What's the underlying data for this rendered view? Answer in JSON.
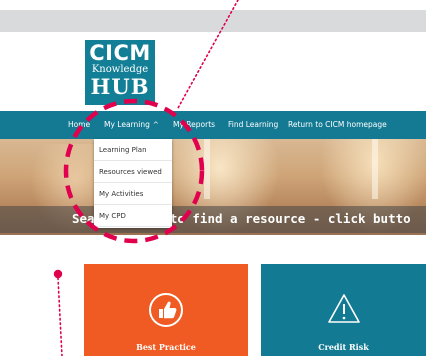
{
  "logo": {
    "line1": "CICM",
    "line2": "Knowledge",
    "line3": "HUB"
  },
  "nav": {
    "items": [
      {
        "label": "Home"
      },
      {
        "label": "My Learning"
      },
      {
        "label": "My Reports"
      },
      {
        "label": "Find Learning"
      },
      {
        "label": "Return to CICM homepage"
      }
    ],
    "caret": "^"
  },
  "dropdown": {
    "items": [
      {
        "label": "Learning Plan"
      },
      {
        "label": "Resources viewed"
      },
      {
        "label": "My Activities"
      },
      {
        "label": "My CPD"
      }
    ]
  },
  "banner": {
    "text": "Sea       earning' to find a resource - click butto"
  },
  "tiles": [
    {
      "label": "Best Practice",
      "icon": "thumbs-up-icon",
      "color": "#ef5b23"
    },
    {
      "label": "Credit Risk",
      "icon": "warning-icon",
      "color": "#137a93"
    }
  ],
  "colors": {
    "brand_teal": "#147a93",
    "accent_orange": "#ef5b23",
    "annotation_red": "#e0004d"
  }
}
